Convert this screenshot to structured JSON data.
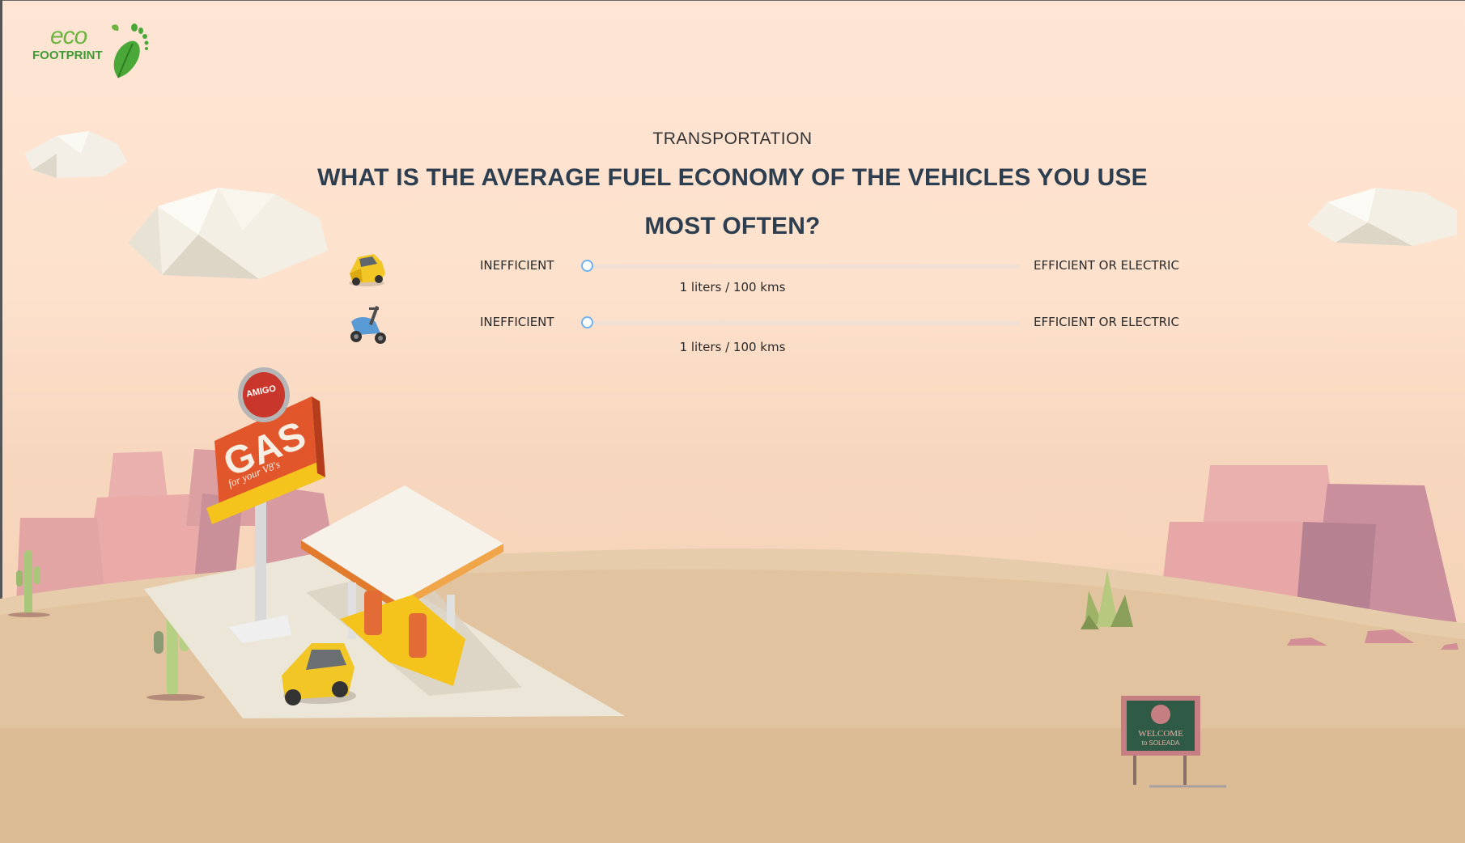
{
  "logo": {
    "line1": "eco",
    "line2": "FOOTPRINT"
  },
  "header": {
    "category": "TRANSPORTATION",
    "question": "WHAT IS THE AVERAGE FUEL ECONOMY OF THE VEHICLES YOU USE MOST OFTEN?"
  },
  "sliders": [
    {
      "vehicle": "car",
      "icon": "car-icon",
      "left_label": "INEFFICIENT",
      "right_label": "EFFICIENT OR ELECTRIC",
      "value_text": "1 liters / 100 kms",
      "value_fraction": 0
    },
    {
      "vehicle": "scooter",
      "icon": "scooter-icon",
      "left_label": "INEFFICIENT",
      "right_label": "EFFICIENT OR ELECTRIC",
      "value_text": "1 liters / 100 kms",
      "value_fraction": 0
    }
  ],
  "scene": {
    "gas_sign": {
      "brand": "AMIGO",
      "sub": "GAS",
      "main": "GAS",
      "tagline": "for your V8's"
    },
    "welcome_sign": {
      "line1": "WELCOME",
      "line2": "to SOLEADA"
    }
  },
  "colors": {
    "accent": "#6fb2ef",
    "heading": "#2c3e4f",
    "brand_green": "#3f9b33"
  }
}
